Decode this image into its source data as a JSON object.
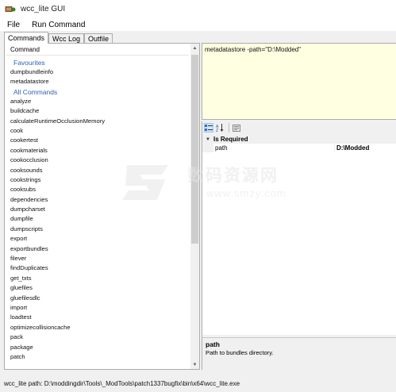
{
  "window": {
    "title": "wcc_lite GUI",
    "icon": "app-icon"
  },
  "menu": [
    "File",
    "Run Command"
  ],
  "tabs": [
    {
      "label": "Commands",
      "active": true
    },
    {
      "label": "Wcc Log",
      "active": false
    },
    {
      "label": "Outfile",
      "active": false
    }
  ],
  "command_list": {
    "header": "Command",
    "favourites_label": "Favourites",
    "favourites": [
      "dumpbundleinfo",
      "metadatastore"
    ],
    "all_label": "All Commands",
    "all": [
      "analyze",
      "buildcache",
      "calculateRuntimeOcclusionMemory",
      "cook",
      "cookertest",
      "cookmaterials",
      "cookocclusion",
      "cooksounds",
      "cookstrings",
      "cooksubs",
      "dependencies",
      "dumpcharset",
      "dumpfile",
      "dumpscripts",
      "export",
      "exportbundles",
      "filever",
      "findDuplicates",
      "get_txts",
      "gluefiles",
      "gluefilesdlc",
      "import",
      "loadtest",
      "optimizecollisioncache",
      "pack",
      "package",
      "patch"
    ]
  },
  "command_text": "metadatastore -path=\"D:\\Modded\"",
  "property_grid": {
    "toolbar_icons": [
      "categorized-icon",
      "alphabetical-icon",
      "property-pages-icon"
    ],
    "category": "Is Required",
    "rows": [
      {
        "name": "path",
        "value": "D:\\Modded"
      }
    ],
    "description_title": "path",
    "description_text": "Path to bundles directory."
  },
  "status": "wcc_lite path: D:\\moddingdir\\Tools\\_ModTools\\patch1337bugfix\\bin\\x64\\wcc_lite.exe",
  "watermark": {
    "text": "数码资源网",
    "url": "www.smzy.com"
  },
  "colors": {
    "accent": "#3063b4",
    "command_bg": "#ffffe1"
  }
}
